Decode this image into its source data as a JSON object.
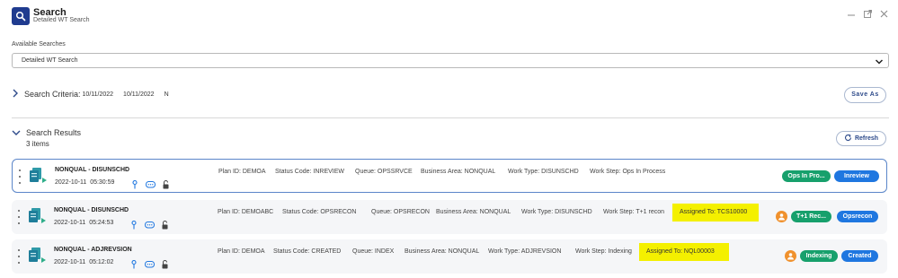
{
  "header": {
    "title": "Search",
    "subtitle": "Detailed WT Search"
  },
  "available": {
    "label": "Available Searches",
    "selected": "Detailed WT Search"
  },
  "criteria": {
    "title": "Search Criteria:",
    "date_from": "10/11/2022",
    "date_to": "10/11/2022",
    "flag": "N",
    "save_label": "Save As"
  },
  "results": {
    "title": "Search Results",
    "count": "3 items",
    "refresh_label": "Refresh",
    "items": [
      {
        "name": "NONQUAL - DISUNSCHD",
        "date": "2022-10-11",
        "time": "05:30:59",
        "plan": "Plan ID: DEMOA",
        "status": "Status Code: INREVIEW",
        "queue": "Queue: OPSSRVCE",
        "area": "Business Area: NONQUAL",
        "wtype": "Work Type: DISUNSCHD",
        "wstep": "Work Step: Ops In Process",
        "assigned": "",
        "badge1": "Ops In Pro...",
        "badge2": "Inreview"
      },
      {
        "name": "NONQUAL - DISUNSCHD",
        "date": "2022-10-11",
        "time": "05:24:53",
        "plan": "Plan ID: DEMOABC",
        "status": "Status Code: OPSRECON",
        "queue": "Queue: OPSRECON",
        "area": "Business Area: NONQUAL",
        "wtype": "Work Type: DISUNSCHD",
        "wstep": "Work Step: T+1 recon",
        "assigned": "Assigned To: TCS10000",
        "badge1": "T+1 Rec...",
        "badge2": "Opsrecon"
      },
      {
        "name": "NONQUAL - ADJREVSION",
        "date": "2022-10-11",
        "time": "05:12:02",
        "plan": "Plan ID: DEMOA",
        "status": "Status Code: CREATED",
        "queue": "Queue: INDEX",
        "area": "Business Area: NONQUAL",
        "wtype": "Work Type: ADJREVSION",
        "wstep": "Work Step: Indexing",
        "assigned": "Assigned To: NQL00003",
        "badge1": "Indexing",
        "badge2": "Created"
      }
    ]
  },
  "colors": {
    "brand": "#1f3b8f",
    "accent_green": "#17a06c",
    "accent_blue": "#1f77e0",
    "highlight": "#f4f000",
    "avatar": "#f0912d"
  },
  "icons": [
    "search-icon",
    "minimize-icon",
    "popout-icon",
    "close-icon",
    "chevron-down-icon",
    "chevron-right-icon",
    "refresh-icon",
    "drag-handle-icon",
    "document-icon",
    "pin-icon",
    "comment-icon",
    "unlock-icon",
    "user-icon"
  ]
}
